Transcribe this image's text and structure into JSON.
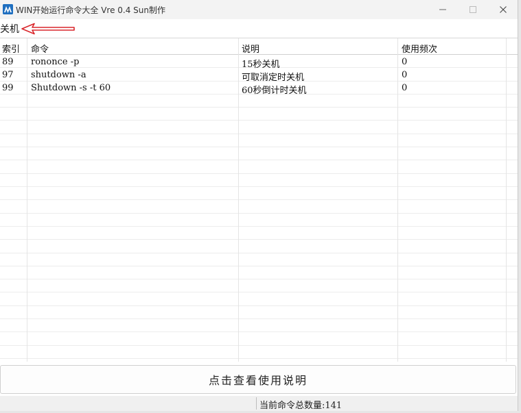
{
  "window": {
    "title": "WIN开始运行命令大全 Vre 0.4   Sun制作",
    "controls": {
      "minimize": "—",
      "maximize": "☐",
      "close": "✕"
    }
  },
  "search": {
    "value": "关机"
  },
  "table": {
    "columns": [
      "索引",
      "命令",
      "说明",
      "使用频次"
    ],
    "rows": [
      {
        "index": "89",
        "command": "rononce -p",
        "description": "15秒关机",
        "frequency": "0"
      },
      {
        "index": "97",
        "command": "shutdown -a",
        "description": "可取消定时关机",
        "frequency": "0"
      },
      {
        "index": "99",
        "command": "Shutdown -s -t 60",
        "description": "60秒倒计时关机",
        "frequency": "0"
      }
    ]
  },
  "help_button": {
    "label": "点击查看使用说明"
  },
  "status": {
    "text": "当前命令总数量:141"
  },
  "colors": {
    "accent": "#1f6fc0",
    "arrow": "#d9262b"
  },
  "icons": {
    "app": "app-logo-icon",
    "annotation": "red-arrow-icon"
  }
}
